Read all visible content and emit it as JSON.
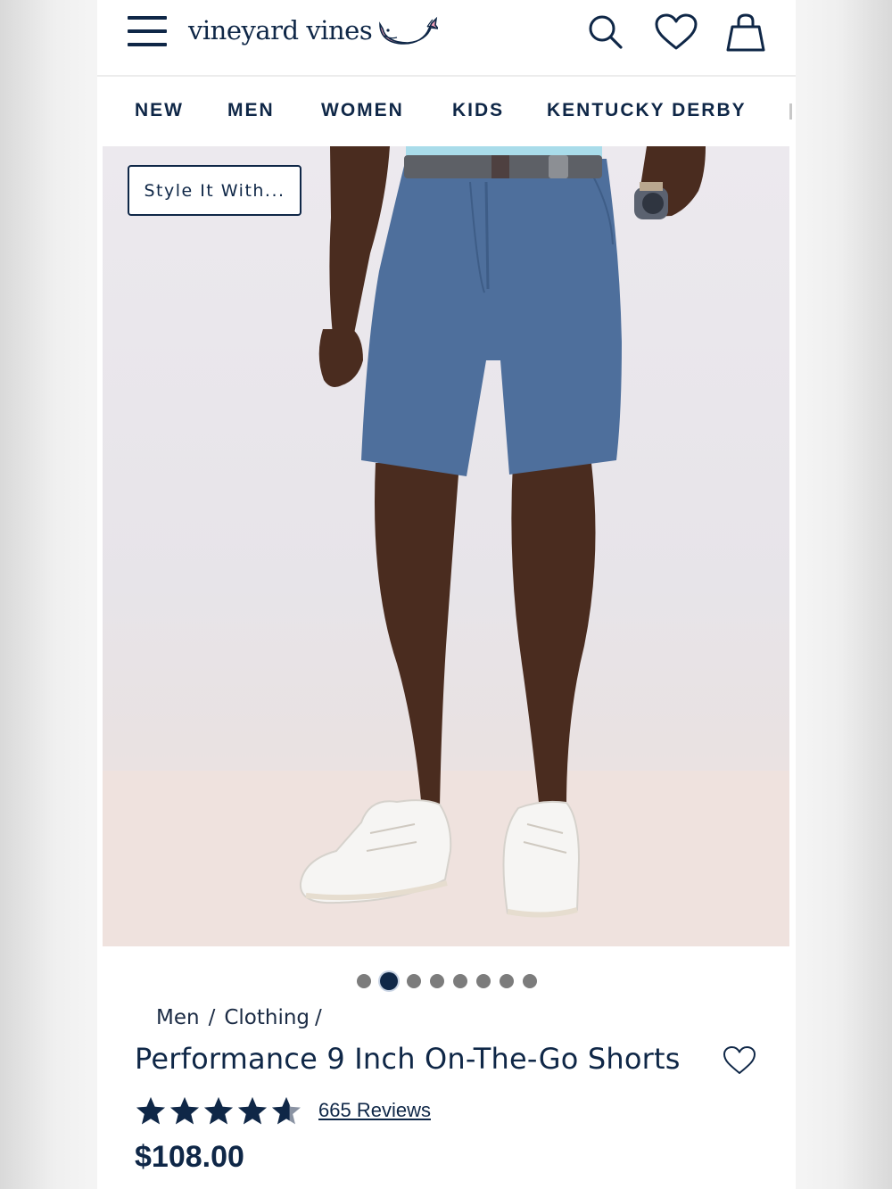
{
  "header": {
    "brand": "vineyard vines",
    "icons": [
      "menu-icon",
      "search-icon",
      "heart-icon",
      "shopping-bag-icon"
    ]
  },
  "nav": {
    "items": [
      "NEW",
      "MEN",
      "WOMEN",
      "KIDS",
      "KENTUCKY DERBY"
    ]
  },
  "product": {
    "style_it_with_label": "Style It With...",
    "image_count": 8,
    "active_image_index": 1,
    "breadcrumb": {
      "level1": "Men",
      "level2": "Clothing",
      "separator": "/"
    },
    "title": "Performance 9 Inch On-The-Go Shorts",
    "rating": 4.6,
    "rating_max": 5,
    "reviews_label": "665 Reviews",
    "price": "$108.00"
  },
  "colors": {
    "navy": "#0f2747",
    "whale_pink": "#f3a1b8",
    "shorts_blue": "#4e6f9c"
  }
}
